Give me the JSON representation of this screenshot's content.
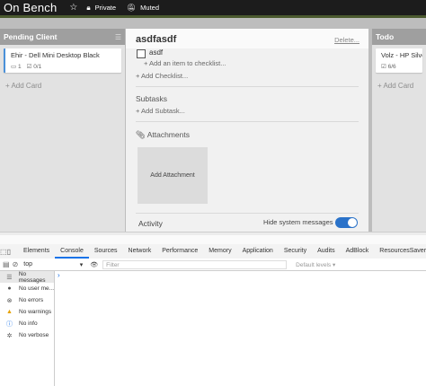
{
  "board": {
    "title": "On Bench",
    "privacy": "Private",
    "notifications": "Muted"
  },
  "lists": [
    {
      "name": "Pending Client",
      "cards": [
        {
          "title": "Ehir - Dell Mini Desktop Black",
          "comments": "1",
          "checklist": "0/1",
          "label_color": "#4a90d9"
        }
      ],
      "add_card": "+ Add Card"
    },
    {
      "name": "Todo",
      "cards": [
        {
          "title": "Volz - HP Silver",
          "checklist": "6/6"
        }
      ],
      "add_card": "+ Add Card"
    }
  ],
  "card_detail": {
    "title": "asdfasdf",
    "delete": "Delete...",
    "checklist_item": "asdf",
    "add_item": "+ Add an item to checklist...",
    "add_checklist": "+ Add Checklist...",
    "subtasks_heading": "Subtasks",
    "add_subtask": "+ Add Subtask...",
    "attachments_heading": "Attachments",
    "add_attachment": "Add Attachment",
    "activity_heading": "Activity",
    "hide_system_messages": "Hide system messages",
    "toggle_on": true
  },
  "devtools": {
    "tabs": [
      "Elements",
      "Console",
      "Sources",
      "Network",
      "Performance",
      "Memory",
      "Application",
      "Security",
      "Audits",
      "AdBlock",
      "ResourcesSaver"
    ],
    "active_tab": "Console",
    "context": "top",
    "filter_placeholder": "Filter",
    "levels": "Default levels ▾",
    "sidebar": [
      {
        "label": "No messages",
        "icon": "list-icon",
        "active": true
      },
      {
        "label": "No user me...",
        "icon": "user-icon"
      },
      {
        "label": "No errors",
        "icon": "error-icon"
      },
      {
        "label": "No warnings",
        "icon": "warning-icon"
      },
      {
        "label": "No info",
        "icon": "info-icon"
      },
      {
        "label": "No verbose",
        "icon": "verbose-icon"
      }
    ],
    "prompt": "›"
  }
}
